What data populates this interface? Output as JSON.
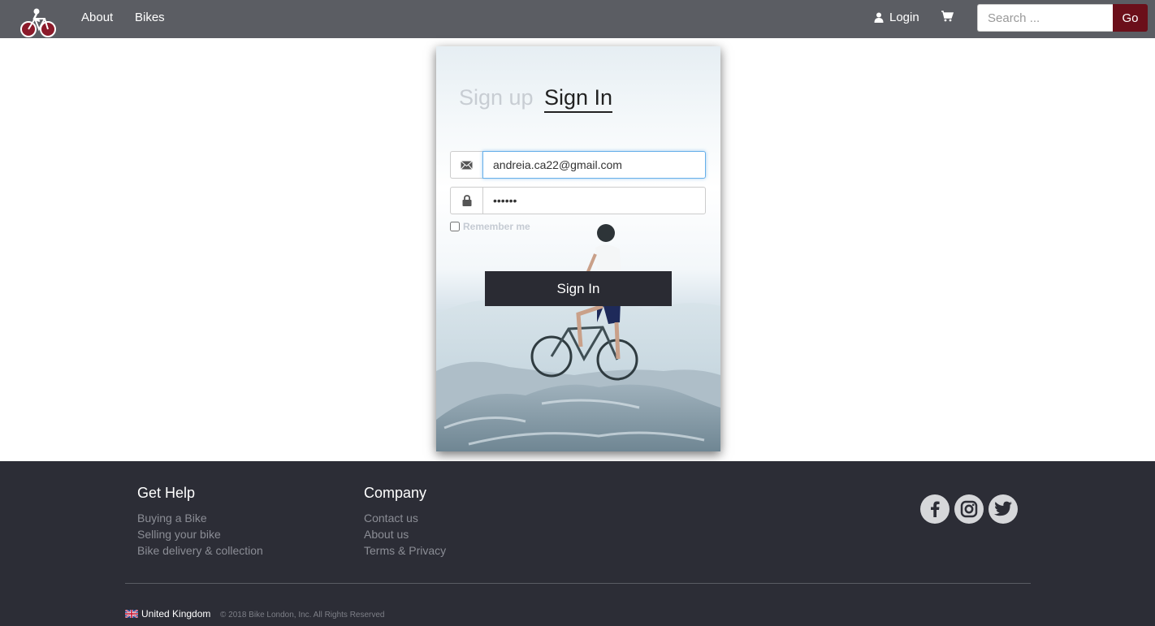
{
  "nav": {
    "about_label": "About",
    "bikes_label": "Bikes",
    "login_label": "Login",
    "search_placeholder": "Search ...",
    "go_label": "Go"
  },
  "login_card": {
    "tab_signup": "Sign up",
    "tab_signin": "Sign In",
    "email_value": "andreia.ca22@gmail.com",
    "password_value": "••••••",
    "remember_label": "Remember me",
    "signin_button": "Sign In"
  },
  "footer": {
    "help_heading": "Get Help",
    "help_links": [
      "Buying a Bike",
      "Selling your bike",
      "Bike delivery & collection"
    ],
    "company_heading": "Company",
    "company_links": [
      "Contact us",
      "About us",
      "Terms & Privacy"
    ],
    "social": [
      "facebook-icon",
      "instagram-icon",
      "twitter-icon"
    ],
    "country": "United Kingdom",
    "copyright": "© 2018 Bike London, Inc. All Rights Reserved"
  },
  "colors": {
    "navbar": "#5b5d63",
    "go_button": "#6b0f1a",
    "footer": "#2c2d36",
    "signin_button": "#2a2b33"
  }
}
